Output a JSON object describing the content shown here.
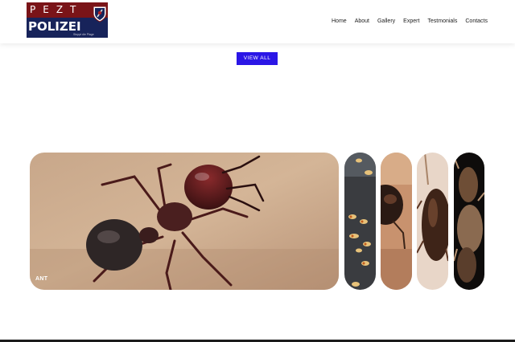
{
  "brand": {
    "logo_top": "PEZT",
    "logo_word": "POLIZEI",
    "logo_tagline": "Stoppt die Plage"
  },
  "nav": {
    "items": [
      "Home",
      "About",
      "Gallery",
      "Expert",
      "Testmonials",
      "Contacts"
    ]
  },
  "actions": {
    "view_all": "VIEW ALL"
  },
  "gallery": {
    "main_caption": "ANT",
    "images": [
      "ant-macro-photo",
      "termites-photo",
      "beetle-closeup-photo",
      "cockroach-photo",
      "insect-closeup-photo"
    ]
  },
  "colors": {
    "logo_red": "#7a1418",
    "logo_navy": "#17235a",
    "button_blue": "#2b16e6",
    "text": "#222222"
  }
}
